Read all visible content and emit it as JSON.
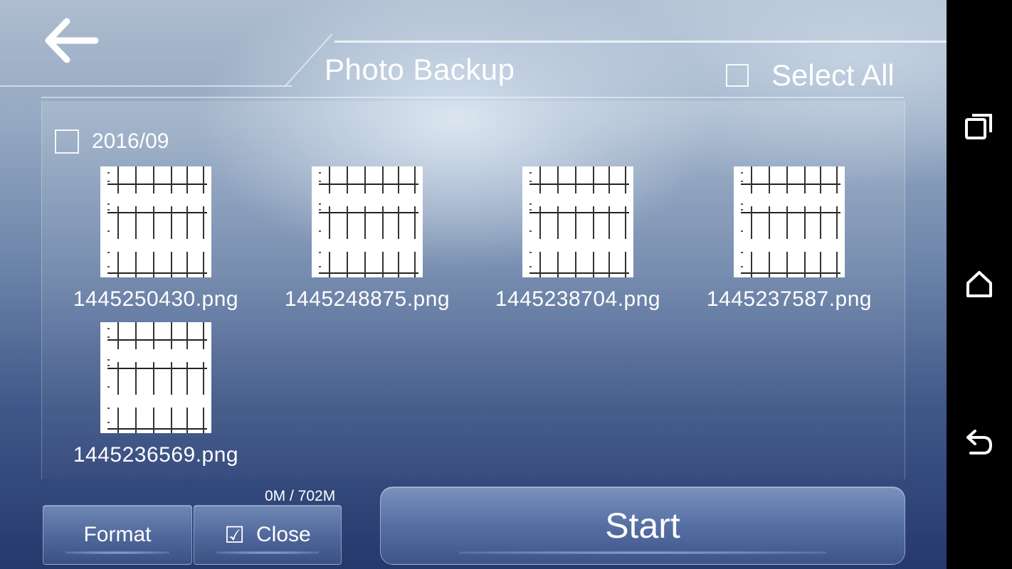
{
  "header": {
    "title": "Photo Backup",
    "select_all_label": "Select All"
  },
  "group": {
    "label": "2016/09"
  },
  "photos": [
    {
      "filename": "1445250430.png"
    },
    {
      "filename": "1445248875.png"
    },
    {
      "filename": "1445238704.png"
    },
    {
      "filename": "1445237587.png"
    },
    {
      "filename": "1445236569.png"
    }
  ],
  "storage": {
    "usage_text": "0M / 702M"
  },
  "footer": {
    "format_label": "Format",
    "close_label": "Close",
    "close_checked_glyph": "☑",
    "start_label": "Start"
  },
  "icons": {
    "back": "back-arrow-icon",
    "checkbox": "checkbox-icon",
    "recents": "recents-icon",
    "home": "home-icon",
    "nav_back": "nav-back-icon"
  },
  "colors": {
    "text": "#ffffff",
    "button_top": "#6f87b4",
    "button_bottom": "#3b5183"
  }
}
